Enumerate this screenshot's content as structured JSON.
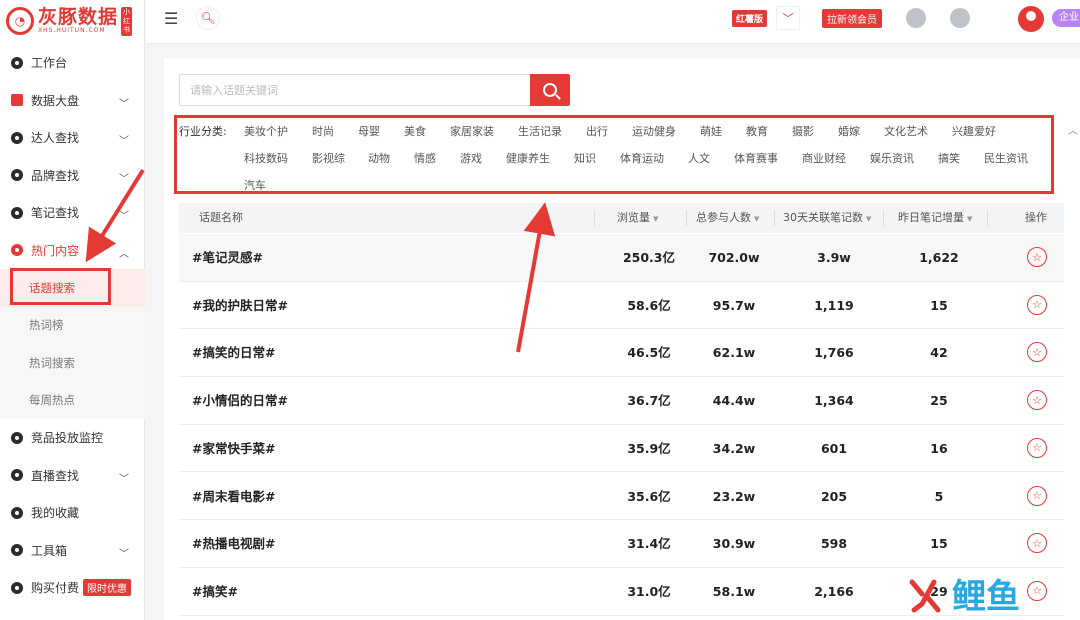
{
  "brand": {
    "name": "灰豚数据",
    "url": "XHS.HUITUN.COM",
    "badge": "小红书"
  },
  "sidebar": {
    "items": [
      {
        "label": "工作台"
      },
      {
        "label": "数据大盘"
      },
      {
        "label": "达人查找"
      },
      {
        "label": "品牌查找"
      },
      {
        "label": "笔记查找"
      },
      {
        "label": "热门内容"
      },
      {
        "label": "竞品投放监控"
      },
      {
        "label": "直播查找"
      },
      {
        "label": "我的收藏"
      },
      {
        "label": "工具箱"
      },
      {
        "label": "购买付费"
      }
    ],
    "sub_items": [
      {
        "label": "话题搜索"
      },
      {
        "label": "热词榜"
      },
      {
        "label": "热词搜索"
      },
      {
        "label": "每周热点"
      }
    ],
    "promo_label": "限时优惠"
  },
  "header": {
    "edition": "红薯版",
    "vip_button": "拉新领会员",
    "enterprise": "企业"
  },
  "search": {
    "placeholder": "请输入话题关键词"
  },
  "categories": {
    "label": "行业分类:",
    "rows": [
      [
        "美妆个护",
        "时尚",
        "母婴",
        "美食",
        "家居家装",
        "生活记录",
        "出行",
        "运动健身",
        "萌娃",
        "教育",
        "摄影",
        "婚嫁",
        "文化艺术",
        "兴趣爱好"
      ],
      [
        "科技数码",
        "影视综",
        "动物",
        "情感",
        "游戏",
        "健康养生",
        "知识",
        "体育运动",
        "人文",
        "体育赛事",
        "商业财经",
        "娱乐资讯",
        "搞笑",
        "民生资讯"
      ],
      [
        "汽车"
      ]
    ]
  },
  "table": {
    "headers": {
      "name": "话题名称",
      "views": "浏览量",
      "participants": "总参与人数",
      "notes30": "30天关联笔记数",
      "yesterday": "昨日笔记增量",
      "action": "操作"
    },
    "rows": [
      {
        "name": "#笔记灵感#",
        "views": "250.3亿",
        "participants": "702.0w",
        "notes30": "3.9w",
        "yesterday": "1,622"
      },
      {
        "name": "#我的护肤日常#",
        "views": "58.6亿",
        "participants": "95.7w",
        "notes30": "1,119",
        "yesterday": "15"
      },
      {
        "name": "#搞笑的日常#",
        "views": "46.5亿",
        "participants": "62.1w",
        "notes30": "1,766",
        "yesterday": "42"
      },
      {
        "name": "#小情侣的日常#",
        "views": "36.7亿",
        "participants": "44.4w",
        "notes30": "1,364",
        "yesterday": "25"
      },
      {
        "name": "#家常快手菜#",
        "views": "35.9亿",
        "participants": "34.2w",
        "notes30": "601",
        "yesterday": "16"
      },
      {
        "name": "#周末看电影#",
        "views": "35.6亿",
        "participants": "23.2w",
        "notes30": "205",
        "yesterday": "5"
      },
      {
        "name": "#热播电视剧#",
        "views": "31.4亿",
        "participants": "30.9w",
        "notes30": "598",
        "yesterday": "15"
      },
      {
        "name": "#搞笑#",
        "views": "31.0亿",
        "participants": "58.1w",
        "notes30": "2,166",
        "yesterday": "29"
      }
    ]
  },
  "watermark": {
    "text": "鲤鱼"
  },
  "colors": {
    "accent": "#e53935",
    "enterprise": "#b983f5"
  }
}
